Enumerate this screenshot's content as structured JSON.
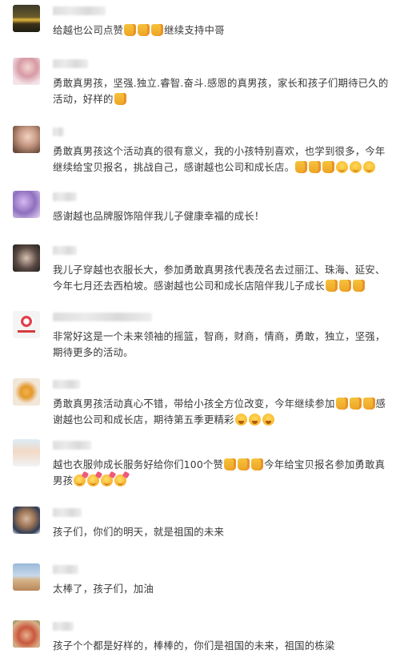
{
  "comments": [
    {
      "avatar": "sunset-landscape-avatar",
      "text": "给越也公司点赞",
      "tail": [
        {
          "emoji": "thumbs-up",
          "after": ""
        },
        {
          "emoji": "thumbs-up",
          "after": ""
        },
        {
          "emoji": "thumbs-up",
          "after": "继续支持中哥"
        }
      ]
    },
    {
      "avatar": "girl-pink-avatar",
      "text": "勇敢真男孩，坚强.独立.睿智.奋斗.感恩的真男孩，家长和孩子们期待已久的活动，好样的",
      "tail": [
        {
          "emoji": "thumbs-up",
          "after": ""
        }
      ]
    },
    {
      "avatar": "woman-portrait-avatar",
      "text": "勇敢真男孩这个活动真的很有意义，我的小孩特别喜欢，也学到很多，今年继续给宝贝报名，挑战自己，感谢越也公司和成长店。",
      "tail": [
        {
          "emoji": "thumbs-up",
          "after": ""
        },
        {
          "emoji": "thumbs-up",
          "after": ""
        },
        {
          "emoji": "thumbs-up",
          "after": ""
        },
        {
          "emoji": "smile",
          "after": ""
        },
        {
          "emoji": "smile",
          "after": ""
        },
        {
          "emoji": "smile",
          "after": ""
        }
      ]
    },
    {
      "avatar": "purple-flowers-avatar",
      "text": "感谢越也品牌服饰陪伴我儿子健康幸福的成长！",
      "tail": []
    },
    {
      "avatar": "dark-portrait-avatar",
      "text": "我儿子穿越也衣服长大，参加勇敢真男孩代表茂名去过丽江、珠海、延安、今年七月还去西柏坡。感谢越也公司和成长店陪伴我儿子成长",
      "tail": [
        {
          "emoji": "thumbs-up",
          "after": ""
        },
        {
          "emoji": "thumbs-up",
          "after": ""
        },
        {
          "emoji": "thumbs-up",
          "after": ""
        }
      ]
    },
    {
      "avatar": "logo-avatar",
      "text": "非常好这是一个未来领袖的摇篮，智商，财商，情商，勇敢，独立，坚强，期待更多的活动。",
      "tail": []
    },
    {
      "avatar": "flower-avatar",
      "text": "勇敢真男孩活动真心不错，带给小孩全方位改变，今年继续参加",
      "tail": [
        {
          "emoji": "thumbs-up",
          "after": ""
        },
        {
          "emoji": "thumbs-up",
          "after": ""
        },
        {
          "emoji": "thumbs-up",
          "after": "感谢越也公司和成长店，期待第五季更精彩"
        },
        {
          "emoji": "grin",
          "after": ""
        },
        {
          "emoji": "grin",
          "after": ""
        },
        {
          "emoji": "grin",
          "after": ""
        }
      ]
    },
    {
      "avatar": "kids-avatar",
      "text": "越也衣服帅成长服务好给你们100个赞",
      "tail": [
        {
          "emoji": "thumbs-up",
          "after": ""
        },
        {
          "emoji": "thumbs-up",
          "after": ""
        },
        {
          "emoji": "thumbs-up",
          "after": "今年给宝贝报名参加勇敢真男孩"
        },
        {
          "emoji": "party-face",
          "after": ""
        },
        {
          "emoji": "party-face",
          "after": ""
        },
        {
          "emoji": "party-face",
          "after": ""
        },
        {
          "emoji": "party-face",
          "after": ""
        }
      ]
    },
    {
      "avatar": "man-portrait-avatar",
      "text": "孩子们，你们的明天，就是祖国的未来",
      "tail": []
    },
    {
      "avatar": "beach-avatar",
      "text": "太棒了，孩子们，加油",
      "tail": []
    },
    {
      "avatar": "child-avatar",
      "text": "孩子个个都是好样的，棒棒的，你们是祖国的未来，祖国的栋梁",
      "tail": []
    }
  ]
}
